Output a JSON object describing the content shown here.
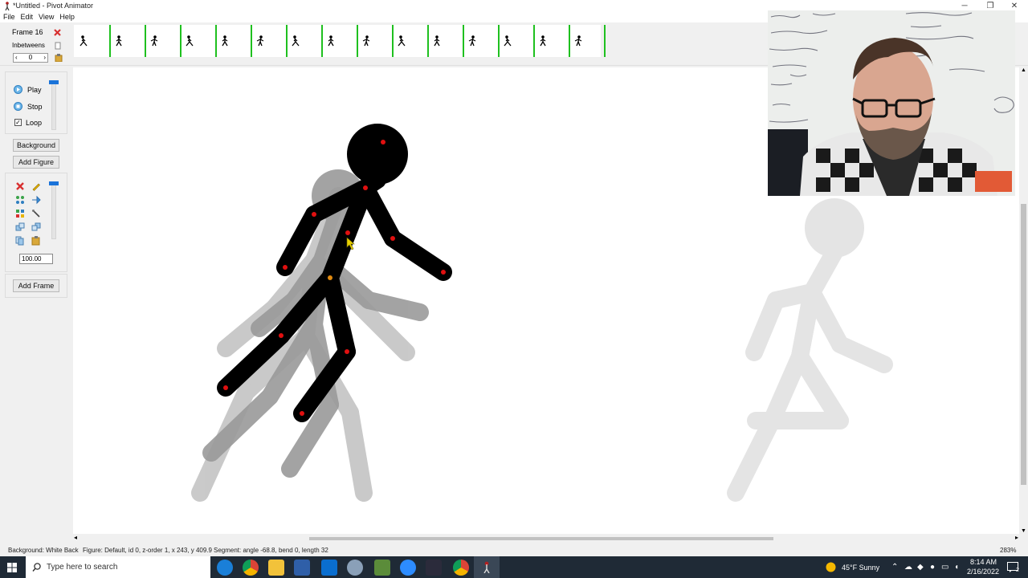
{
  "window": {
    "title": "*Untitled - Pivot Animator"
  },
  "menu": [
    "File",
    "Edit",
    "View",
    "Help"
  ],
  "frame_panel": {
    "frame_label": "Frame 16",
    "inbetweens_label": "Inbetweens",
    "inbetweens_value": "0"
  },
  "playback": {
    "play": "Play",
    "stop": "Stop",
    "loop": "Loop",
    "loop_checked": true
  },
  "buttons": {
    "background": "Background",
    "add_figure": "Add Figure",
    "add_frame": "Add Frame"
  },
  "scale_value": "100.00",
  "frame_count": 15,
  "status": {
    "background": "Background: White Back",
    "figure": "Figure: Default,  id 0,  z-order 1,  x 243, y 409.9",
    "segment": "Segment: angle -68.8,  bend 0,  length 32",
    "zoom": "283%"
  },
  "taskbar": {
    "search_placeholder": "Type here to search",
    "weather": "45°F  Sunny",
    "time": "8:14 AM",
    "date": "2/16/2022",
    "notifications": "2"
  },
  "colors": {
    "frame_marker": "#1fc01f",
    "joint": "#e01010",
    "origin_joint": "#e08a10",
    "slider": "#1a73d9",
    "onion_1": "#b9b9b9",
    "onion_2": "#9a9a9a",
    "ghost_figure": "#e4e4e4"
  }
}
